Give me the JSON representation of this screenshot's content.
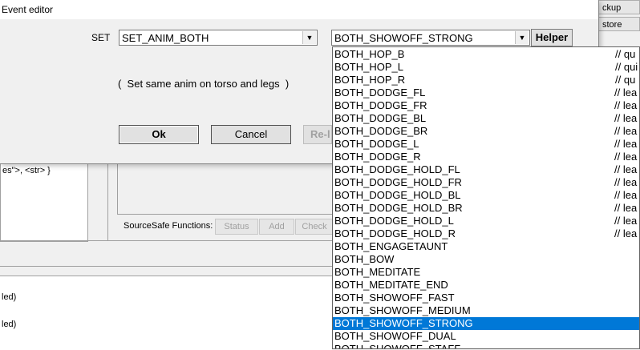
{
  "dialog": {
    "title": "Event editor",
    "set_label": "SET",
    "set_value": "SET_ANIM_BOTH",
    "anim_value": "BOTH_SHOWOFF_STRONG",
    "helper_label": "Helper",
    "description": "(  Set same anim on torso and legs  )",
    "ok_label": "Ok",
    "cancel_label": "Cancel",
    "reload_label": "Re-l"
  },
  "dropdown": {
    "items": [
      {
        "name": "BOTH_HOP_B",
        "comment": "// qu"
      },
      {
        "name": "BOTH_HOP_L",
        "comment": "// qui"
      },
      {
        "name": "BOTH_HOP_R",
        "comment": "// qu"
      },
      {
        "name": "BOTH_DODGE_FL",
        "comment": "// lea"
      },
      {
        "name": "BOTH_DODGE_FR",
        "comment": "// lea"
      },
      {
        "name": "BOTH_DODGE_BL",
        "comment": "// lea"
      },
      {
        "name": "BOTH_DODGE_BR",
        "comment": "// lea"
      },
      {
        "name": "BOTH_DODGE_L",
        "comment": "// lea"
      },
      {
        "name": "BOTH_DODGE_R",
        "comment": "// lea"
      },
      {
        "name": "BOTH_DODGE_HOLD_FL",
        "comment": "// lea"
      },
      {
        "name": "BOTH_DODGE_HOLD_FR",
        "comment": "// lea"
      },
      {
        "name": "BOTH_DODGE_HOLD_BL",
        "comment": "// lea"
      },
      {
        "name": "BOTH_DODGE_HOLD_BR",
        "comment": "// lea"
      },
      {
        "name": "BOTH_DODGE_HOLD_L",
        "comment": "// lea"
      },
      {
        "name": "BOTH_DODGE_HOLD_R",
        "comment": "// lea"
      },
      {
        "name": "BOTH_ENGAGETAUNT",
        "comment": ""
      },
      {
        "name": "BOTH_BOW",
        "comment": ""
      },
      {
        "name": "BOTH_MEDITATE",
        "comment": ""
      },
      {
        "name": "BOTH_MEDITATE_END",
        "comment": ""
      },
      {
        "name": "BOTH_SHOWOFF_FAST",
        "comment": ""
      },
      {
        "name": "BOTH_SHOWOFF_MEDIUM",
        "comment": ""
      },
      {
        "name": "BOTH_SHOWOFF_STRONG",
        "comment": "",
        "selected": true
      },
      {
        "name": "BOTH_SHOWOFF_DUAL",
        "comment": ""
      },
      {
        "name": "BOTH_SHOWOFF_STAFF",
        "comment": ""
      }
    ]
  },
  "background": {
    "right_btn_top": "ckup",
    "right_btn_bottom": "store",
    "left_list_text": "es\">, <str>  }",
    "sourcesafe_label": "SourceSafe Functions:",
    "sourcesafe_buttons": [
      "Status",
      "Add",
      "Check"
    ],
    "bottom_text_1": "led)",
    "bottom_text_2": "led)"
  },
  "colors": {
    "selection": "#0078d7",
    "window_bg": "#f0f0f0"
  }
}
